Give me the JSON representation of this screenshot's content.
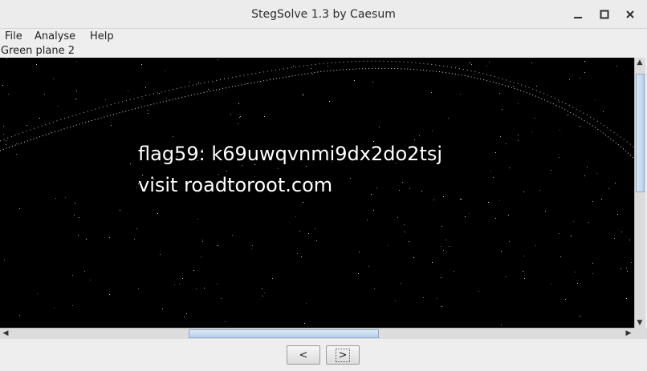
{
  "window": {
    "title": "StegSolve 1.3 by Caesum"
  },
  "menu": {
    "items": [
      {
        "label": "File"
      },
      {
        "label": "Analyse"
      },
      {
        "label": "Help"
      }
    ]
  },
  "plane_label": "Green plane 2",
  "image": {
    "lines": [
      "flag59: k69uwqvnmi9dx2do2tsj",
      "visit roadtoroot.com"
    ]
  },
  "nav": {
    "prev_label": "<",
    "next_label": ">"
  },
  "colors": {
    "viewport_bg": "#000000",
    "text": "#ffffff",
    "scroll_thumb": "#b8d0ea"
  }
}
